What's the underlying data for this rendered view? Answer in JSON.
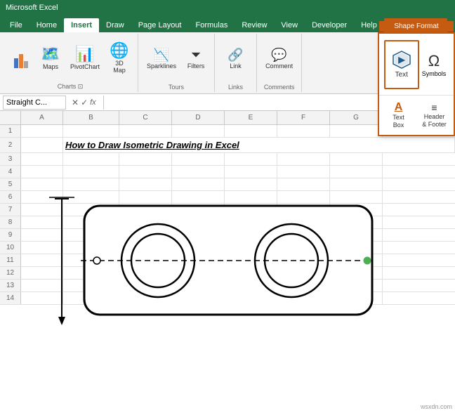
{
  "title_bar": {
    "text": "Microsoft Excel"
  },
  "ribbon_tabs": [
    {
      "label": "File",
      "active": false
    },
    {
      "label": "Home",
      "active": false
    },
    {
      "label": "Insert",
      "active": true
    },
    {
      "label": "Draw",
      "active": false
    },
    {
      "label": "Page Layout",
      "active": false
    },
    {
      "label": "Formulas",
      "active": false
    },
    {
      "label": "Review",
      "active": false
    },
    {
      "label": "View",
      "active": false
    },
    {
      "label": "Developer",
      "active": false
    },
    {
      "label": "Help",
      "active": false
    },
    {
      "label": "Shape Format",
      "active": false,
      "highlighted": true
    }
  ],
  "ribbon_groups": [
    {
      "label": "Charts",
      "buttons": [
        {
          "icon": "📊",
          "label": ""
        },
        {
          "icon": "🗺️",
          "label": "Maps"
        },
        {
          "icon": "📈",
          "label": "PivotChart"
        },
        {
          "icon": "🗾",
          "label": "3D Map"
        }
      ]
    },
    {
      "label": "Tours",
      "buttons": [
        {
          "icon": "✨",
          "label": "Sparklines"
        },
        {
          "icon": "🔽",
          "label": "Filters"
        }
      ]
    },
    {
      "label": "Links",
      "buttons": [
        {
          "icon": "🔗",
          "label": "Link"
        }
      ]
    },
    {
      "label": "Comments",
      "buttons": [
        {
          "icon": "💬",
          "label": "Comment"
        }
      ]
    }
  ],
  "text_panel": {
    "shape_format_label": "Shape Format",
    "top_button": {
      "icon": "▶",
      "label": "Text"
    },
    "bottom_buttons": [
      {
        "icon": "A",
        "label": "Text\nBox"
      },
      {
        "icon": "≡",
        "label": "Header\n& Footer"
      }
    ]
  },
  "formula_bar": {
    "name_box": "Straight C...",
    "formula_text": ""
  },
  "columns": [
    "A",
    "B",
    "C",
    "D",
    "E",
    "F",
    "G"
  ],
  "rows": [
    {
      "num": "1",
      "cells": [
        "",
        "",
        "",
        "",
        "",
        "",
        ""
      ]
    },
    {
      "num": "2",
      "cells": [
        "",
        "",
        "",
        "",
        "",
        "",
        ""
      ],
      "title": "How to Draw Isometric Drawing in Excel"
    },
    {
      "num": "3",
      "cells": [
        "",
        "",
        "",
        "",
        "",
        "",
        ""
      ]
    },
    {
      "num": "4",
      "cells": [
        "",
        "",
        "",
        "",
        "",
        "",
        ""
      ]
    },
    {
      "num": "5",
      "cells": [
        "",
        "",
        "",
        "",
        "",
        "",
        ""
      ]
    },
    {
      "num": "6",
      "cells": [
        "",
        "",
        "",
        "",
        "",
        "",
        ""
      ]
    },
    {
      "num": "7",
      "cells": [
        "",
        "",
        "",
        "",
        "",
        "",
        ""
      ]
    },
    {
      "num": "8",
      "cells": [
        "",
        "",
        "",
        "",
        "",
        "",
        ""
      ]
    },
    {
      "num": "9",
      "cells": [
        "",
        "",
        "",
        "",
        "",
        "",
        ""
      ]
    },
    {
      "num": "10",
      "cells": [
        "",
        "",
        "",
        "",
        "",
        "",
        ""
      ]
    },
    {
      "num": "11",
      "cells": [
        "",
        "",
        "",
        "",
        "",
        "",
        ""
      ]
    },
    {
      "num": "12",
      "cells": [
        "",
        "",
        "",
        "",
        "",
        "",
        ""
      ]
    },
    {
      "num": "13",
      "cells": [
        "",
        "",
        "",
        "",
        "",
        "",
        ""
      ]
    },
    {
      "num": "14",
      "cells": [
        "",
        "",
        "",
        "",
        "",
        "",
        ""
      ]
    }
  ],
  "watermark": "wsxdn.com"
}
